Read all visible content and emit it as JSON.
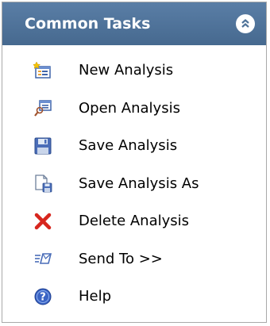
{
  "panel": {
    "title": "Common Tasks",
    "collapse_icon": "double-chevron-up-icon",
    "header_color": "#4f7399"
  },
  "items": [
    {
      "label": "New Analysis",
      "icon": "new-analysis-icon"
    },
    {
      "label": "Open Analysis",
      "icon": "open-analysis-icon"
    },
    {
      "label": "Save Analysis",
      "icon": "save-icon"
    },
    {
      "label": "Save Analysis As",
      "icon": "save-as-icon"
    },
    {
      "label": "Delete Analysis",
      "icon": "delete-icon"
    },
    {
      "label": "Send To >>",
      "icon": "send-to-icon"
    },
    {
      "label": "Help",
      "icon": "help-icon"
    }
  ]
}
